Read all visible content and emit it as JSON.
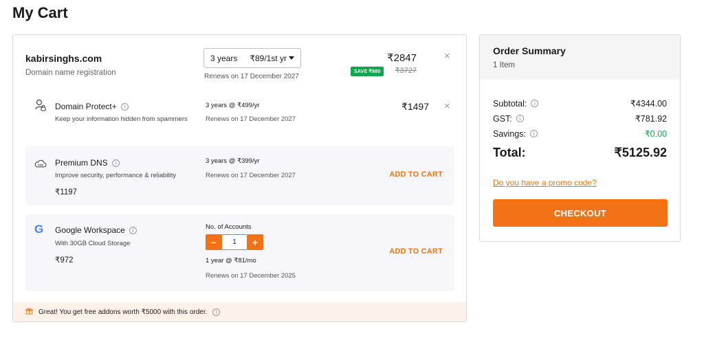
{
  "page": {
    "title": "My Cart"
  },
  "domain": {
    "name": "kabirsinghs.com",
    "subtitle": "Domain name registration",
    "term_years": "3 years",
    "term_price": "₹89/1st yr",
    "renews": "Renews on 17 December 2027",
    "price": "₹2847",
    "save_badge": "SAVE ₹880",
    "original_price": "₹3727",
    "remove": "×"
  },
  "protect": {
    "title": "Domain Protect+",
    "desc": "Keep your information hidden from spammers",
    "term": "3 years @ ₹499/yr",
    "renews": "Renews on 17 December 2027",
    "price": "₹1497",
    "remove": "×"
  },
  "dns": {
    "title": "Premium DNS",
    "desc": "Improve security, performance & reliability",
    "price": "₹1197",
    "term": "3 years @ ₹399/yr",
    "renews": "Renews on 17 December 2027",
    "cta": "ADD TO CART"
  },
  "workspace": {
    "title": "Google Workspace",
    "desc": "With 30GB Cloud Storage",
    "price": "₹972",
    "accounts_label": "No. of Accounts",
    "accounts_value": "1",
    "minus": "−",
    "plus": "+",
    "term": "1 year @ ₹81/mo",
    "renews": "Renews on 17 December 2025",
    "cta": "ADD TO CART"
  },
  "promo_banner": {
    "text": "Great! You get free addons worth ₹5000 with this order."
  },
  "summary": {
    "title": "Order Summary",
    "count": "1 Item",
    "subtotal_label": "Subtotal:",
    "subtotal": "₹4344.00",
    "gst_label": "GST:",
    "gst": "₹781.92",
    "savings_label": "Savings:",
    "savings": "₹0.00",
    "total_label": "Total:",
    "total": "₹5125.92",
    "promo_link": "Do you have a promo code?",
    "checkout": "CHECKOUT"
  },
  "icons": {
    "info": "i",
    "google_g": "G",
    "dns_tag": "DNS"
  },
  "colors": {
    "accent": "#f47216",
    "success": "#14a44d",
    "panel_bg": "#f7f7fb",
    "banner_bg": "#fdf2e9"
  }
}
